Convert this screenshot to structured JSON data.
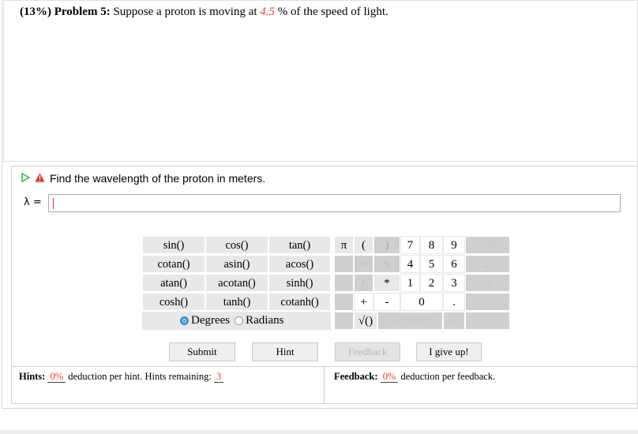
{
  "problem": {
    "percent": "(13%)",
    "label": "Problem 5:",
    "text_before": "Suppose a proton is moving at",
    "value": "4.5",
    "text_after": "% of the speed of light."
  },
  "part": {
    "prompt": "Find the wavelength of the proton in meters.",
    "answer_label": "λ =",
    "answer_value": ""
  },
  "functions": [
    [
      "sin()",
      "cos()",
      "tan()"
    ],
    [
      "cotan()",
      "asin()",
      "acos()"
    ],
    [
      "atan()",
      "acotan()",
      "sinh()"
    ],
    [
      "cosh()",
      "tanh()",
      "cotanh()"
    ]
  ],
  "angle_mode": {
    "degrees": "Degrees",
    "radians": "Radians",
    "selected": "degrees"
  },
  "keypad": {
    "pi": "π",
    "lparen": "(",
    "rparen": ")",
    "up": "↑^",
    "down": "^↓",
    "divide": "/",
    "multiply": "*",
    "plus": "+",
    "minus": "-",
    "sqrt": "√()",
    "dot": ".",
    "digits": [
      "7",
      "8",
      "9",
      "4",
      "5",
      "6",
      "1",
      "2",
      "3",
      "0"
    ],
    "home": "HOME",
    "left": "←",
    "right": "→",
    "end": "END",
    "backspace": "BACKSPACE",
    "del": "DEL",
    "clear": "CLEAR"
  },
  "buttons": {
    "submit": "Submit",
    "hint": "Hint",
    "feedback": "Feedback",
    "give_up": "I give up!"
  },
  "hints": {
    "label": "Hints:",
    "pct": "0%",
    "text": "deduction per hint. Hints remaining:",
    "remaining": "3"
  },
  "feedback": {
    "label": "Feedback:",
    "pct": "0%",
    "text": "deduction per feedback."
  },
  "colors": {
    "highlight": "#e8412c",
    "key_bg": "#e8e8e8",
    "key_dark": "#cfcfcf",
    "radio": "#2f8fd8"
  }
}
